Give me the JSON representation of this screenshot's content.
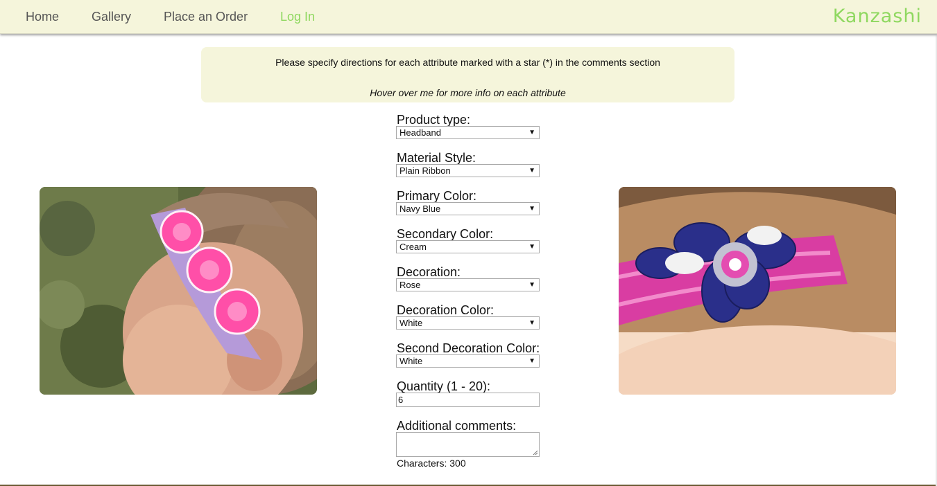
{
  "nav": {
    "items": [
      {
        "label": "Home"
      },
      {
        "label": "Gallery"
      },
      {
        "label": "Place an Order"
      },
      {
        "label": "Log In"
      }
    ],
    "brand": "Kanzashi"
  },
  "info": {
    "line1": "Please specify directions for each attribute marked with a star (*) in the comments section",
    "line2": "Hover over me for more info on each attribute"
  },
  "form": {
    "product_type": {
      "label": "Product type:",
      "value": "Headband"
    },
    "material_style": {
      "label": "Material Style:",
      "value": "Plain Ribbon"
    },
    "primary_color": {
      "label": "Primary Color:",
      "value": "Navy Blue"
    },
    "secondary_color": {
      "label": "Secondary Color:",
      "value": "Cream"
    },
    "decoration": {
      "label": "Decoration:",
      "value": "Rose"
    },
    "decoration_color": {
      "label": "Decoration Color:",
      "value": "White"
    },
    "second_decoration_color": {
      "label": "Second Decoration Color:",
      "value": "White"
    },
    "quantity": {
      "label": "Quantity (1 - 20):",
      "value": "6"
    },
    "comments": {
      "label": "Additional comments:",
      "value": ""
    },
    "char_count": "Characters: 300"
  },
  "images": {
    "left": "pink-rose-headband-photo",
    "right": "navy-flower-headband-photo"
  },
  "colors": {
    "nav_bg": "#f5f5db",
    "brand": "#8fd860",
    "active_link": "#8fd860"
  }
}
